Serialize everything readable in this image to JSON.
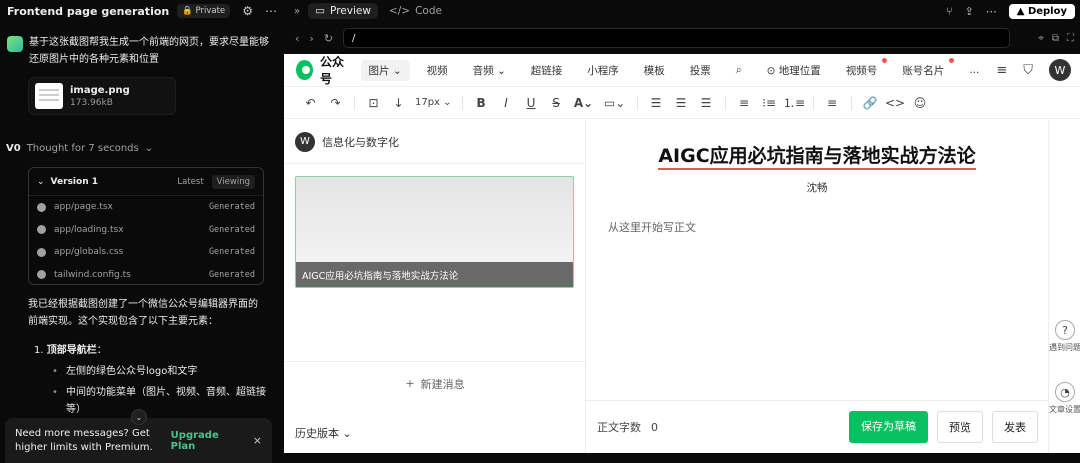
{
  "left": {
    "title": "Frontend page generation",
    "privacy": "Private",
    "user_message": "基于这张截图帮我生成一个前端的网页，要求尽量能够还原图片中的各种元素和位置",
    "file": {
      "name": "image.png",
      "size": "173.96kB"
    },
    "thought": "Thought for 7 seconds",
    "version": {
      "name": "Version 1",
      "latest": "Latest",
      "viewing": "Viewing",
      "files": [
        {
          "name": "app/page.tsx",
          "status": "Generated"
        },
        {
          "name": "app/loading.tsx",
          "status": "Generated"
        },
        {
          "name": "app/globals.css",
          "status": "Generated"
        },
        {
          "name": "tailwind.config.ts",
          "status": "Generated"
        }
      ]
    },
    "reply": "我已经根据截图创建了一个微信公众号编辑器界面的前端实现。这个实现包含了以下主要元素：",
    "section1": "1.",
    "section1_title": "顶部导航栏",
    "bullets": [
      "左侧的绿色公众号logo和文字",
      "中间的功能菜单（图片、视频、音频、超链接等）"
    ],
    "upgrade": {
      "text": "Need more messages? Get higher limits with Premium.",
      "button": "Upgrade Plan",
      "close": "×"
    }
  },
  "topbar": {
    "preview": "Preview",
    "code": "Code",
    "deploy": "Deploy"
  },
  "url": "/",
  "wx": {
    "brand": "公众号",
    "nav": [
      {
        "label": "图片 ⌄",
        "selected": true
      },
      {
        "label": "视频"
      },
      {
        "label": "音频 ⌄"
      },
      {
        "label": "超链接"
      },
      {
        "label": "小程序"
      },
      {
        "label": "模板"
      },
      {
        "label": "投票"
      },
      {
        "label": "⌕"
      },
      {
        "label": "⊙ 地理位置"
      },
      {
        "label": "视频号",
        "dot": true
      },
      {
        "label": "账号名片",
        "dot": true
      },
      {
        "label": "..."
      }
    ],
    "user_initial": "W",
    "font_size": "17px ⌄",
    "account_name": "信息化与数字化",
    "card_caption": "AIGC应用必坑指南与落地实战方法论",
    "new_message": "新建消息",
    "history": "历史版本 ⌄",
    "article_title": "AIGC应用必坑指南与落地实战方法论",
    "author": "沈畅",
    "body_placeholder": "从这里开始写正文",
    "word_count_label": "正文字数",
    "word_count": "0",
    "save_draft": "保存为草稿",
    "preview_btn": "预览",
    "publish": "发表",
    "help": "遇到问题",
    "settings": "文章设置"
  },
  "colors": {
    "accent": "#07c160",
    "title_underline": "#e05a5a",
    "upgrade_link": "#4cc38a"
  }
}
